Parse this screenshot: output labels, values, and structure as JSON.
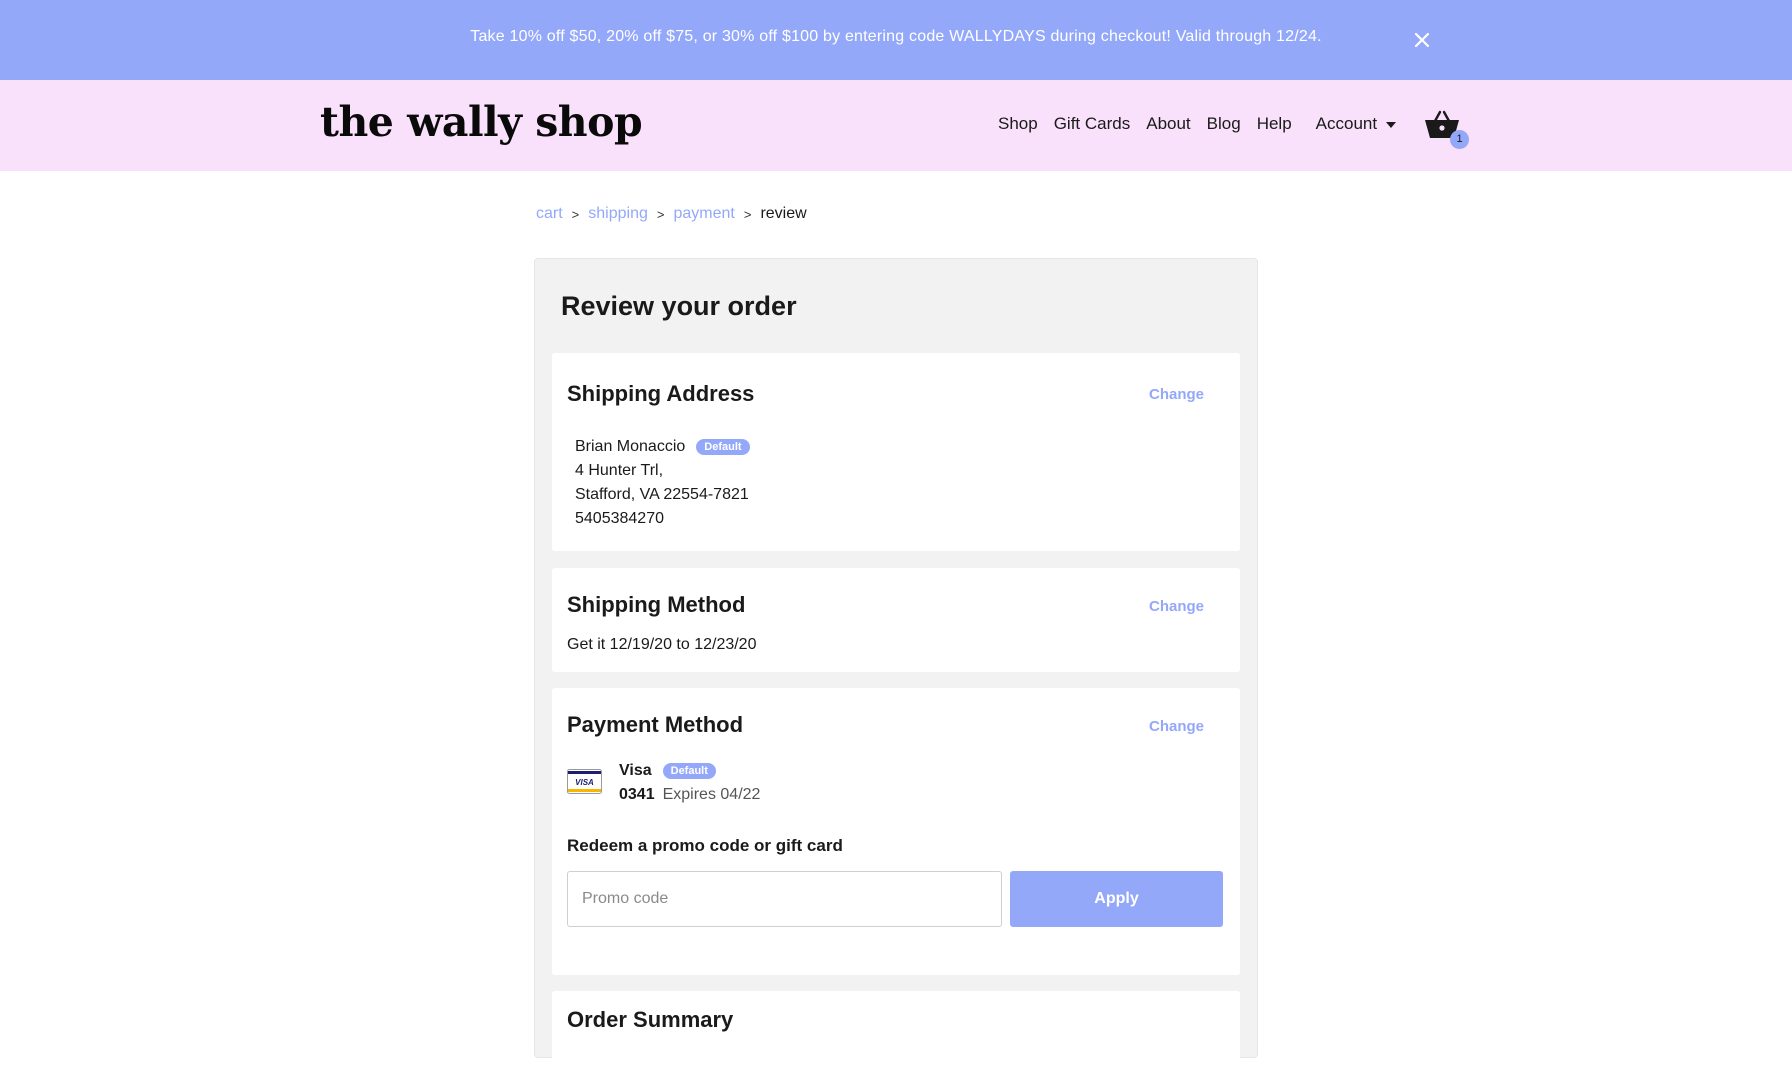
{
  "promo_banner": {
    "text": "Take 10% off $50, 20% off $75, or 30% off $100 by entering code WALLYDAYS during checkout! Valid through 12/24.",
    "close_icon": "close-icon"
  },
  "header": {
    "logo": "the wally shop",
    "nav": {
      "shop": "Shop",
      "gift_cards": "Gift Cards",
      "about": "About",
      "blog": "Blog",
      "help": "Help",
      "account": "Account"
    },
    "cart": {
      "icon": "basket-icon",
      "count": "1"
    }
  },
  "breadcrumb": {
    "cart": "cart",
    "shipping": "shipping",
    "payment": "payment",
    "review": "review",
    "separator": ">"
  },
  "review": {
    "title": "Review your order",
    "shipping_address": {
      "title": "Shipping Address",
      "change": "Change",
      "name": "Brian Monaccio",
      "badge": "Default",
      "line1": "4 Hunter Trl,",
      "line2": "Stafford, VA 22554-7821",
      "phone": "5405384270"
    },
    "shipping_method": {
      "title": "Shipping Method",
      "change": "Change",
      "text": "Get it 12/19/20 to 12/23/20"
    },
    "payment_method": {
      "title": "Payment Method",
      "change": "Change",
      "card_icon": "visa-card-icon",
      "card_icon_text": "VISA",
      "brand": "Visa",
      "badge": "Default",
      "last4": "0341",
      "expires": "Expires 04/22",
      "redeem_label": "Redeem a promo code or gift card",
      "promo_placeholder": "Promo code",
      "promo_value": "",
      "apply": "Apply"
    },
    "order_summary": {
      "title": "Order Summary"
    }
  },
  "colors": {
    "banner": "#94a8fa",
    "header": "#f9e1fb",
    "accent": "#94a8fa",
    "panel": "#f2f2f2"
  }
}
